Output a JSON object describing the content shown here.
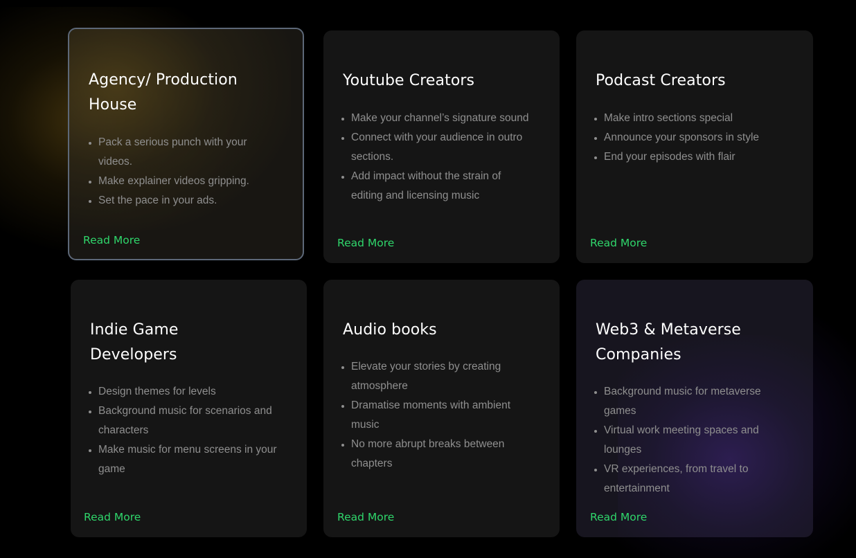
{
  "accent_color": "#2fd66b",
  "cards": [
    {
      "title_line1": "Agency/ Production",
      "title_line2": "House",
      "bullets": [
        "Pack a serious punch with your videos.",
        "Make explainer videos gripping.",
        "Set the pace in your ads."
      ],
      "link": "Read More"
    },
    {
      "title_line1": "Youtube Creators",
      "bullets": [
        "Make your channel’s signature sound",
        "Connect with your audience in outro sections.",
        "Add impact without the strain of editing and licensing music"
      ],
      "link": "Read More"
    },
    {
      "title_line1": "Podcast Creators",
      "bullets": [
        "Make intro sections special",
        "Announce your sponsors in style",
        "End your episodes with flair"
      ],
      "link": "Read More"
    },
    {
      "title_line1": "Indie Game",
      "title_line2": "Developers",
      "bullets": [
        "Design themes for levels",
        "Background music for scenarios and characters",
        "Make music for menu screens in your game"
      ],
      "link": "Read More"
    },
    {
      "title_line1": "Audio books",
      "bullets": [
        "Elevate your stories by creating atmosphere",
        "Dramatise moments with ambient music",
        "No more abrupt breaks between chapters"
      ],
      "link": "Read More"
    },
    {
      "title_line1": "Web3 & Metaverse",
      "title_line2": "Companies",
      "bullets": [
        "Background music for metaverse games",
        "Virtual work meeting spaces and lounges",
        "VR experiences, from travel to entertainment"
      ],
      "link": "Read More"
    }
  ]
}
